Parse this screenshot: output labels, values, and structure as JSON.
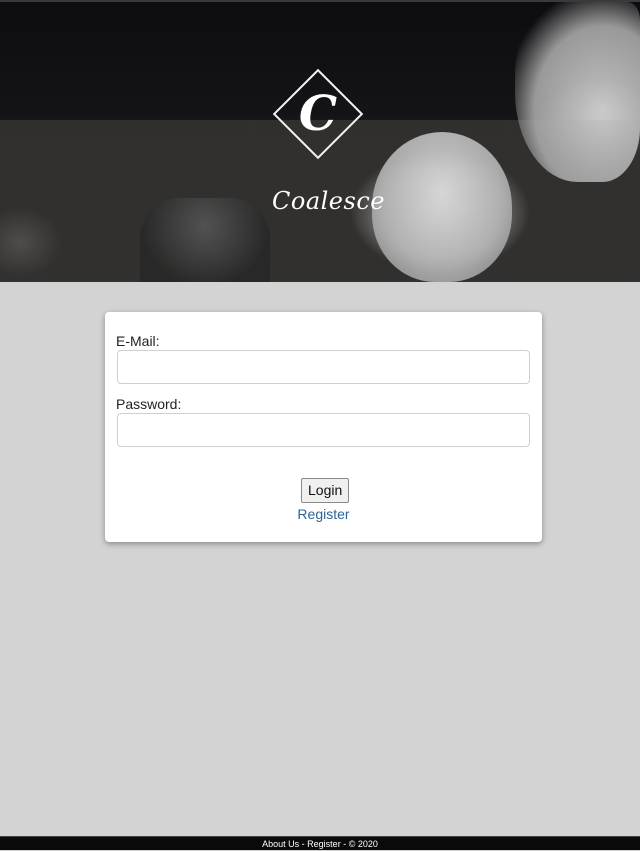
{
  "header": {
    "logo_letter": "C",
    "brand_name": "Coalesce"
  },
  "login_form": {
    "email_label": "E-Mail:",
    "email_value": "",
    "password_label": "Password:",
    "password_value": "",
    "login_button_label": "Login",
    "register_link_label": "Register"
  },
  "footer": {
    "about_label": "About Us",
    "separator": "-",
    "register_label": "Register",
    "copyright": "© 2020"
  },
  "colors": {
    "background": "#d3d3d3",
    "link": "#2a6496",
    "footer_bg": "#0a0a0a"
  }
}
